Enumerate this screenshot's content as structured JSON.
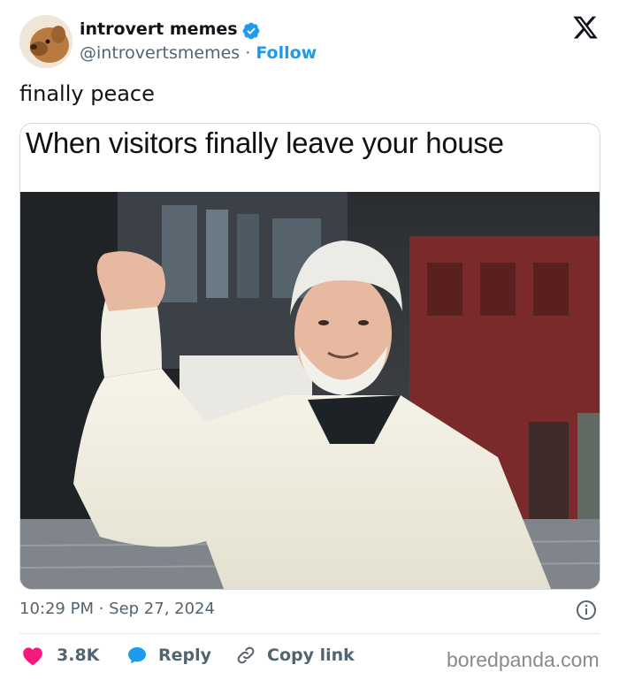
{
  "author": {
    "name": "introvert memes",
    "handle": "@introvertsmemes",
    "separator": "·",
    "follow_label": "Follow",
    "verified": true,
    "avatar_icon": "dog-avatar"
  },
  "brand_icon": "x-logo-icon",
  "tweet": {
    "text": "finally peace"
  },
  "media": {
    "caption": "When visitors finally leave your house",
    "image_icon": "man-waving-photo"
  },
  "meta": {
    "timestamp": "10:29 PM · Sep 27, 2024"
  },
  "actions": {
    "likes": "3.8K",
    "reply_label": "Reply",
    "copy_label": "Copy link"
  },
  "watermark": "boredpanda.com",
  "colors": {
    "accent": "#1d9bf0",
    "like": "#f91880",
    "text": "#0f1419",
    "muted": "#536471"
  }
}
